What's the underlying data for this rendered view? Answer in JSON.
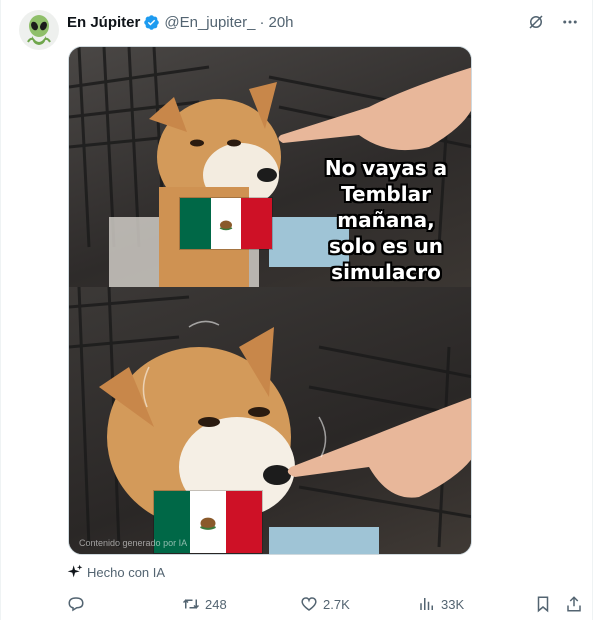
{
  "author": {
    "display_name": "En Júpiter",
    "handle": "@En_jupiter_",
    "separator": "·",
    "time": "20h",
    "avatar_icon": "alien-icon",
    "verified_color": "#1d9bf0"
  },
  "media": {
    "caption_lines": [
      "No vayas a",
      "Temblar",
      "mañana,",
      "solo es un",
      "simulacro"
    ],
    "watermark": "Contenido generado por IA",
    "flag_colors": {
      "green": "#006847",
      "white": "#ffffff",
      "red": "#ce1126"
    }
  },
  "ai_label": {
    "icon": "sparkle-icon",
    "text": "Hecho con IA"
  },
  "actions": {
    "reply": {
      "icon": "reply-icon",
      "count": ""
    },
    "retweet": {
      "icon": "retweet-icon",
      "count": "248"
    },
    "like": {
      "icon": "heart-icon",
      "count": "2.7K"
    },
    "views": {
      "icon": "views-icon",
      "count": "33K"
    },
    "bookmark": {
      "icon": "bookmark-icon"
    },
    "share": {
      "icon": "share-icon"
    }
  }
}
